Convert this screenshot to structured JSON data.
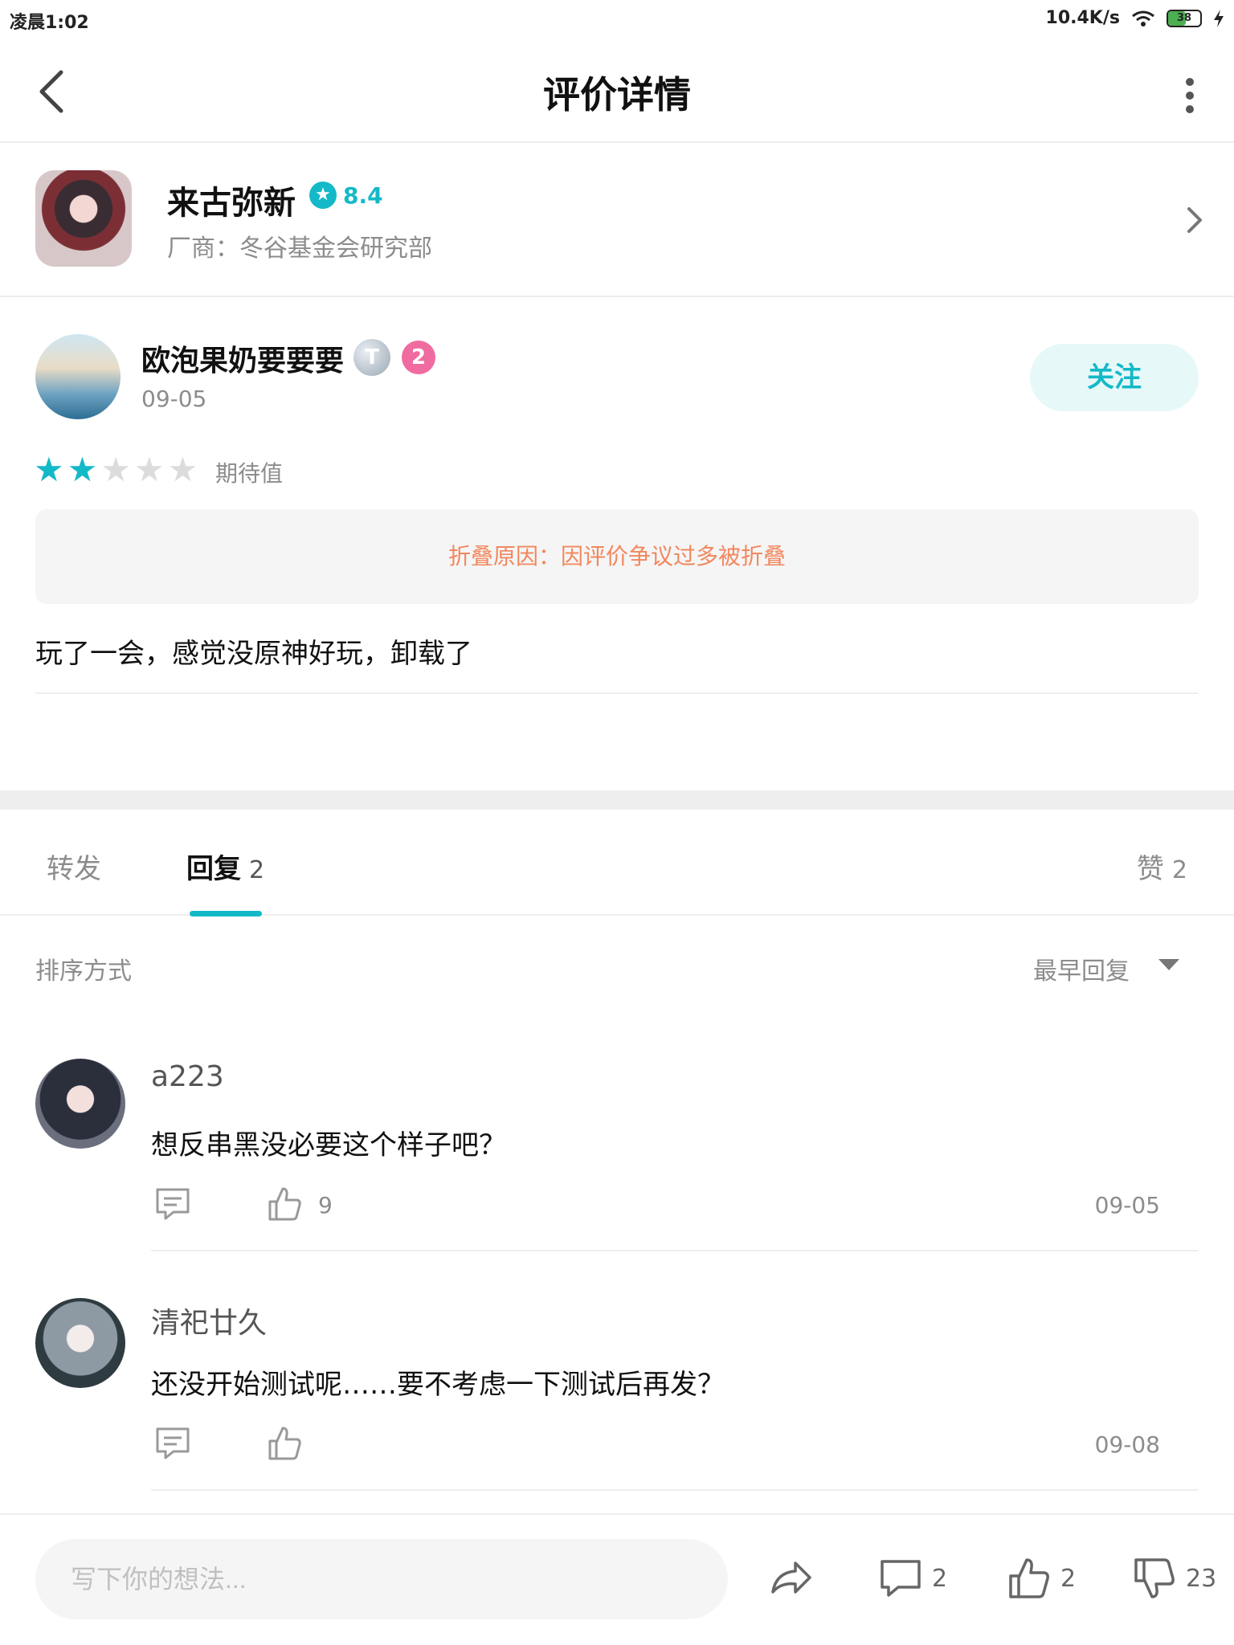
{
  "status_bar": {
    "time": "凌晨1:02",
    "speed": "10.4K/s",
    "battery": "38"
  },
  "nav": {
    "title": "评价详情"
  },
  "game": {
    "name": "来古弥新",
    "score": "8.4",
    "vendor": "厂商：冬谷基金会研究部"
  },
  "review": {
    "user": "欧泡果奶要要要",
    "badge_t": "T",
    "badge_level": "2",
    "date": "09-05",
    "follow_label": "关注",
    "stars": 2,
    "stars_max": 5,
    "rating_label": "期待值",
    "fold_notice": "折叠原因：因评价争议过多被折叠",
    "text": "玩了一会，感觉没原神好玩，卸载了"
  },
  "tabs": [
    {
      "label": "转发",
      "count": ""
    },
    {
      "label": "回复",
      "count": "2"
    },
    {
      "label": "赞",
      "count": "2"
    }
  ],
  "sort": {
    "label": "排序方式",
    "value": "最早回复"
  },
  "replies": [
    {
      "name": "a223",
      "text": "想反串黑没必要这个样子吧？",
      "likes": "9",
      "date": "09-05"
    },
    {
      "name": "清祀廿久",
      "text": "还没开始测试呢……要不考虑一下测试后再发？",
      "likes": "",
      "date": "09-08"
    }
  ],
  "bottom_bar": {
    "placeholder": "写下你的想法...",
    "comments": "2",
    "likes": "2",
    "dislikes": "23"
  },
  "colors": {
    "accent": "#14b9c8",
    "fold_text": "#f2875d",
    "badge_pink": "#f06ba0"
  }
}
